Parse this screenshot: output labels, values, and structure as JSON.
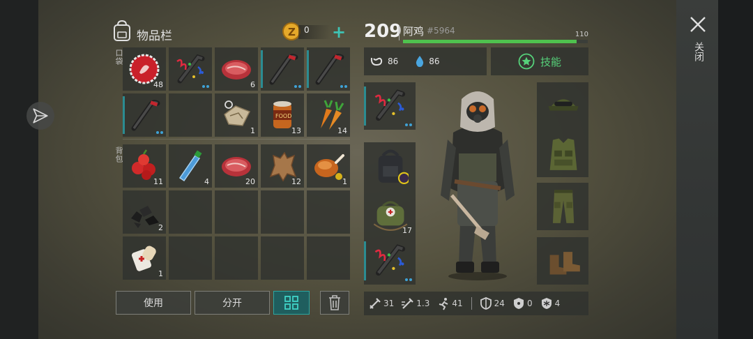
{
  "inventory": {
    "title": "物品栏",
    "coins": "0",
    "pocket_label": "口袋",
    "backpack_label": "背包",
    "pocket_slots": [
      {
        "icon": "bottle-cap-icon",
        "count": "48"
      },
      {
        "icon": "party-crowbar-icon",
        "count": "",
        "dots": true
      },
      {
        "icon": "raw-meat-icon",
        "count": "6"
      },
      {
        "icon": "crowbar-icon",
        "count": "",
        "dots": true,
        "bar": true
      },
      {
        "icon": "crowbar-icon",
        "count": "",
        "dots": true,
        "bar": true
      },
      {
        "icon": "crowbar-icon",
        "count": "",
        "dots": true,
        "bar": true
      },
      {
        "icon": "empty",
        "count": ""
      },
      {
        "icon": "map-piece-icon",
        "count": "1"
      },
      {
        "icon": "canned-food-icon",
        "count": "13"
      },
      {
        "icon": "carrot-icon",
        "count": "14"
      }
    ],
    "backpack_slots": [
      {
        "icon": "berries-icon",
        "count": "11"
      },
      {
        "icon": "water-bottle-icon",
        "count": "4"
      },
      {
        "icon": "raw-meat-icon",
        "count": "20"
      },
      {
        "icon": "leather-icon",
        "count": "12"
      },
      {
        "icon": "roast-chicken-icon",
        "count": "1"
      },
      {
        "icon": "coal-icon",
        "count": "2"
      },
      {
        "icon": "empty",
        "count": ""
      },
      {
        "icon": "empty",
        "count": ""
      },
      {
        "icon": "empty",
        "count": ""
      },
      {
        "icon": "empty",
        "count": ""
      },
      {
        "icon": "bandage-icon",
        "count": "1"
      },
      {
        "icon": "empty",
        "count": ""
      },
      {
        "icon": "empty",
        "count": ""
      },
      {
        "icon": "empty",
        "count": ""
      },
      {
        "icon": "empty",
        "count": ""
      }
    ],
    "buttons": {
      "use": "使用",
      "split": "分开"
    }
  },
  "character": {
    "level": "209",
    "name": "阿鸡",
    "id": "#5964",
    "xp_max": "110",
    "xp_fraction": 0.94,
    "food": "86",
    "water": "86",
    "skills_label": "技能",
    "left_slots": [
      {
        "icon": "party-crowbar-icon",
        "count": "",
        "dots": true,
        "bar": true
      },
      {
        "icon": "backpack-icon",
        "count": ""
      },
      {
        "icon": "medkit-bag-icon",
        "count": "17"
      },
      {
        "icon": "party-crowbar-icon",
        "count": "",
        "dots": true,
        "bar": true
      }
    ],
    "right_slots": [
      {
        "icon": "cap-icon"
      },
      {
        "icon": "vest-icon"
      },
      {
        "icon": "pants-icon"
      },
      {
        "icon": "boots-icon"
      }
    ],
    "stats": [
      {
        "icon": "sword-icon",
        "value": "31"
      },
      {
        "icon": "attack-speed-icon",
        "value": "1.3"
      },
      {
        "icon": "run-icon",
        "value": "41"
      },
      {
        "icon": "armor-icon",
        "value": "24"
      },
      {
        "icon": "radiation-icon",
        "value": "0"
      },
      {
        "icon": "cold-icon",
        "value": "4"
      }
    ]
  },
  "close_label": "关闭",
  "colors": {
    "accent": "#3ec4b5",
    "xp": "#4fc24e",
    "skill": "#56d27a"
  }
}
